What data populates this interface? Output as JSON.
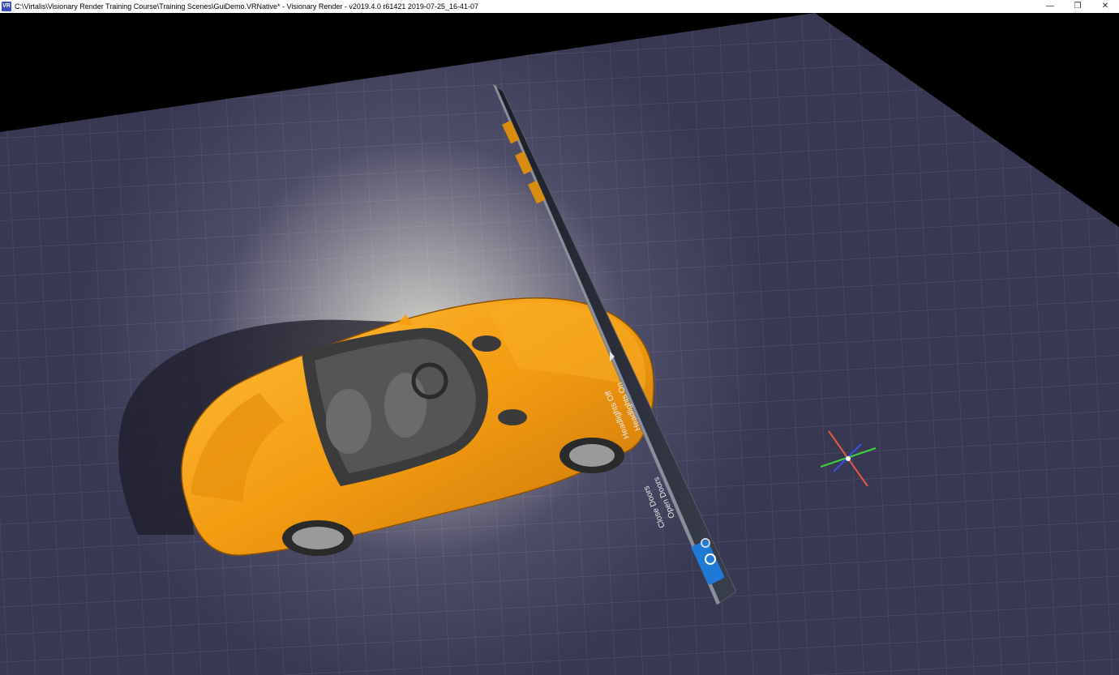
{
  "window": {
    "app_icon_text": "VR",
    "title": "C:\\Virtalis\\Visionary Render Training Course\\Training Scenes\\GuiDemo.VRNative* - Visionary Render - v2019.4.0 r61421 2019-07-25_16-41-07",
    "minimize_glyph": "—",
    "restore_glyph": "❐",
    "close_glyph": "✕"
  },
  "colors": {
    "floor": "#3a3a55",
    "car_body": "#f5a014",
    "panel": "#2b2f3a",
    "panel_button": "#1f7ad6"
  },
  "scene_panel": {
    "labels": [
      "Open Doors",
      "Close Doors",
      "Headlights On",
      "Headlights Off"
    ],
    "icons": [
      "door-open-icon",
      "headlight-icon"
    ]
  }
}
